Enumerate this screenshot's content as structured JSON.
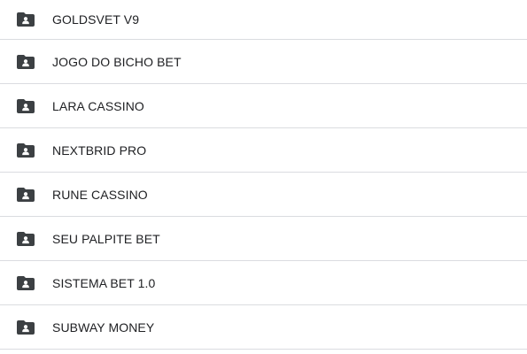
{
  "folder_list": {
    "items": [
      {
        "label": "GOLDSVET V9",
        "icon": "shared-folder-icon"
      },
      {
        "label": "JOGO DO BICHO BET",
        "icon": "shared-folder-icon"
      },
      {
        "label": "LARA CASSINO",
        "icon": "shared-folder-icon"
      },
      {
        "label": "NEXTBRID PRO",
        "icon": "shared-folder-icon"
      },
      {
        "label": "RUNE CASSINO",
        "icon": "shared-folder-icon"
      },
      {
        "label": "SEU PALPITE BET",
        "icon": "shared-folder-icon"
      },
      {
        "label": "SISTEMA BET 1.0",
        "icon": "shared-folder-icon"
      },
      {
        "label": "SUBWAY MONEY",
        "icon": "shared-folder-icon"
      }
    ]
  },
  "colors": {
    "text": "#202124",
    "icon": "#3c4043",
    "divider": "#dadce0",
    "background": "#ffffff"
  }
}
